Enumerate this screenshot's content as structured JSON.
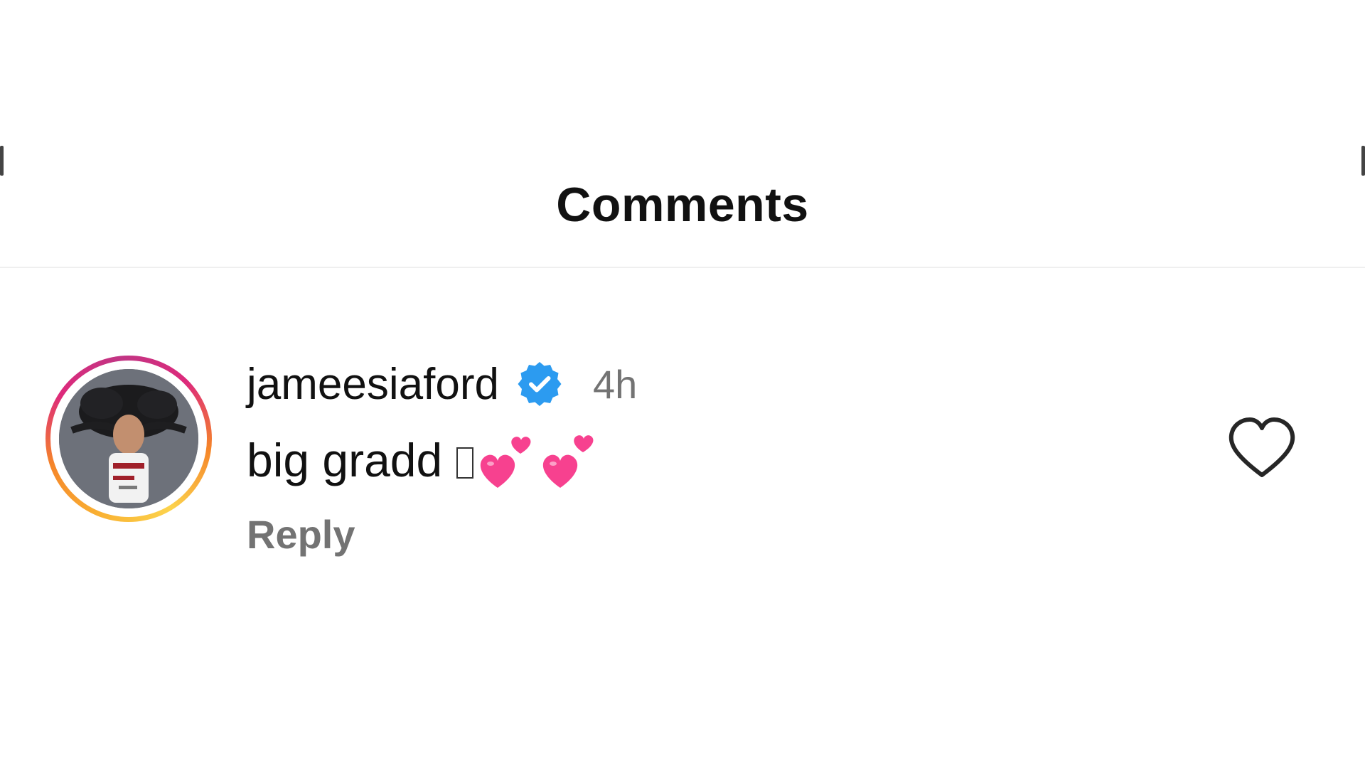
{
  "header": {
    "title": "Comments"
  },
  "comment": {
    "username": "jameesiaford",
    "verified": true,
    "timestamp": "4h",
    "text": "big gradd",
    "emoji_icon": "two-hearts",
    "reply_label": "Reply",
    "liked": false
  },
  "colors": {
    "verified_blue": "#2C9BF0",
    "heart_pink": "#F7418F",
    "secondary_text": "#737373",
    "story_ring_start": "#F9B233",
    "story_ring_end": "#C13584"
  },
  "icons": {
    "verified": "verified-badge-icon",
    "like": "heart-outline-icon",
    "emoji": "two-hearts-icon"
  }
}
